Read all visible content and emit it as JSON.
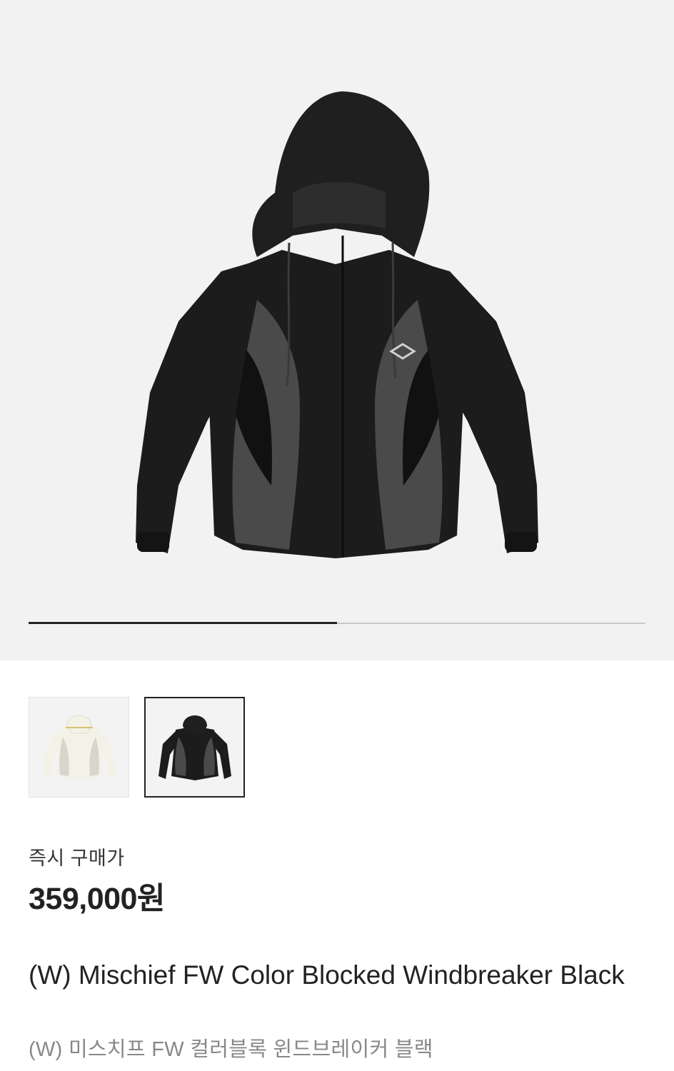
{
  "gallery": {
    "main_image_alt": "(W) Mischief FW Color Blocked Windbreaker Black",
    "progress_fraction": 0.5,
    "thumbnails": [
      {
        "color": "white",
        "selected": false
      },
      {
        "color": "black",
        "selected": true
      }
    ]
  },
  "price": {
    "label": "즉시 구매가",
    "value": "359,000원"
  },
  "product": {
    "name_en": "(W) Mischief FW Color Blocked Windbreaker Black",
    "name_ko": "(W) 미스치프 FW 컬러블록 윈드브레이커 블랙"
  },
  "colors": {
    "background_hero": "#f2f2f2",
    "jacket_black": "#1c1c1c",
    "jacket_gray": "#4a4a4a",
    "jacket_white": "#f4f1e6",
    "jacket_white_panel": "#d9d4cc"
  }
}
